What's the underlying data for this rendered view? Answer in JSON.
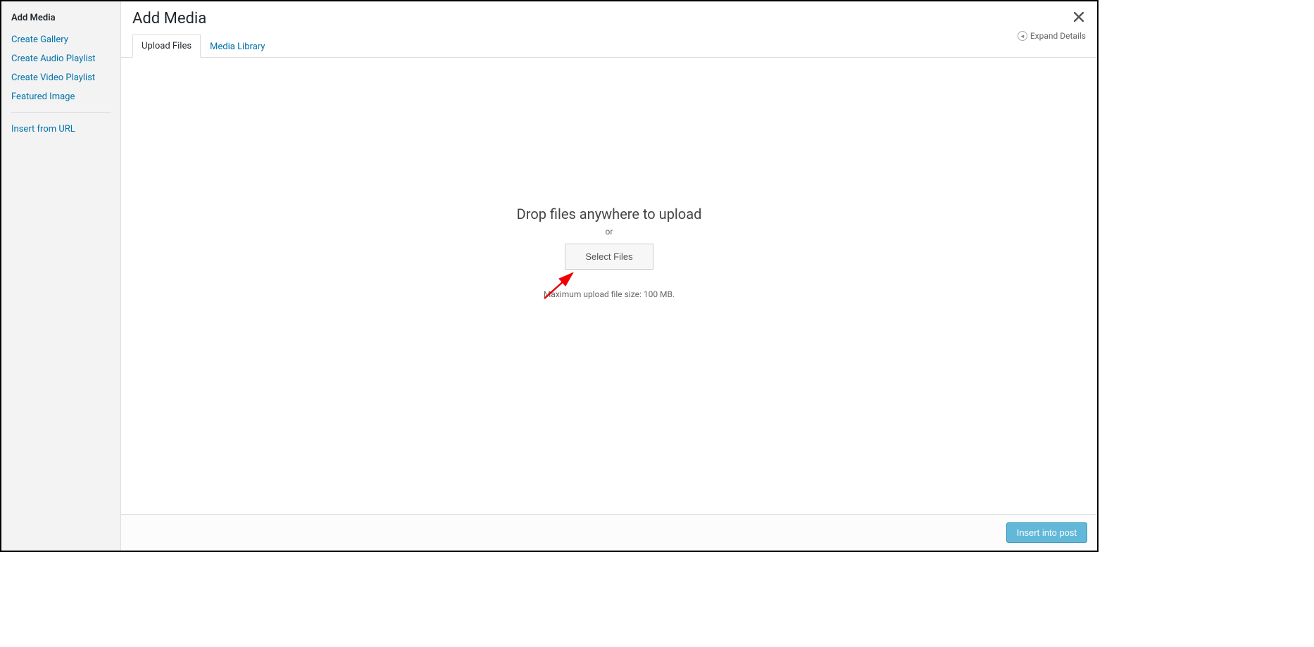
{
  "sidebar": {
    "title": "Add Media",
    "items_top": [
      "Create Gallery",
      "Create Audio Playlist",
      "Create Video Playlist",
      "Featured Image"
    ],
    "items_bottom": [
      "Insert from URL"
    ]
  },
  "header": {
    "title": "Add Media",
    "expand_label": "Expand Details"
  },
  "tabs": {
    "upload": "Upload Files",
    "library": "Media Library"
  },
  "upload": {
    "drop_text": "Drop files anywhere to upload",
    "or_text": "or",
    "select_btn": "Select Files",
    "max_size": "Maximum upload file size: 100 MB."
  },
  "footer": {
    "insert_btn": "Insert into post"
  }
}
